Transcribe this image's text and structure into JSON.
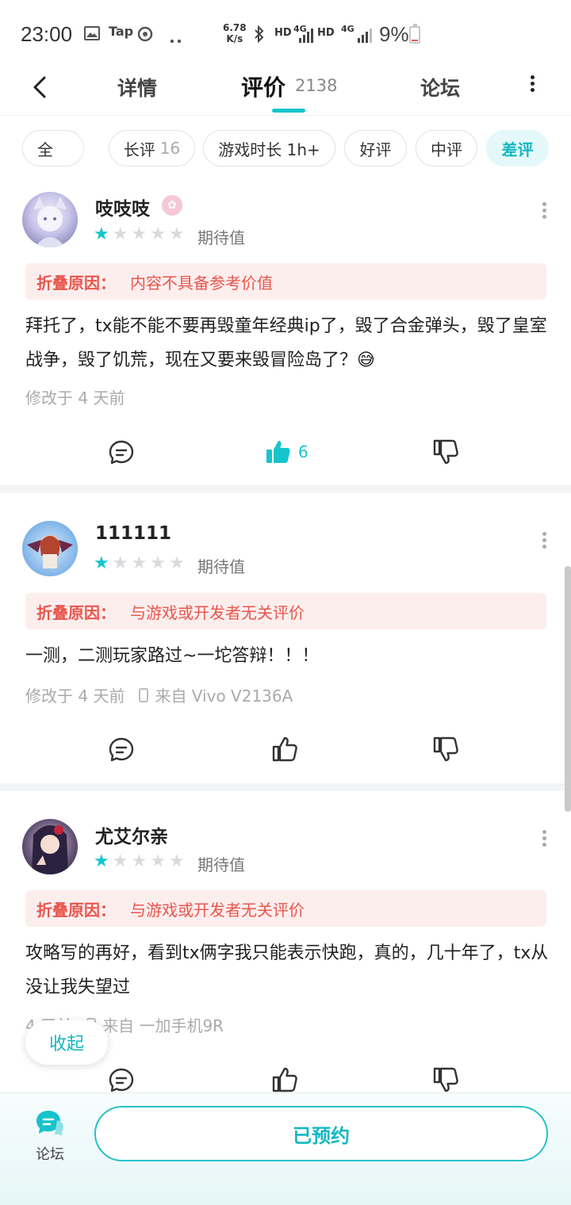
{
  "status_bar": {
    "time": "23:00",
    "icons": [
      "image-icon",
      "tap-icon",
      "refresh-icon",
      "more-dots-icon"
    ],
    "tap_label": "Tap",
    "net_speed_value": "6.78",
    "net_speed_unit": "K/s",
    "hd1": "HD",
    "net1": "4G",
    "hd2": "HD",
    "net2": "4G",
    "battery": "9%"
  },
  "nav": {
    "tabs": [
      {
        "label": "详情"
      },
      {
        "label": "评价",
        "count": "2138"
      },
      {
        "label": "论坛"
      }
    ],
    "active_tab": "评价",
    "accent_color": "#15c5ce"
  },
  "filters": [
    {
      "label": "全"
    },
    {
      "label": "长评",
      "count": "16"
    },
    {
      "label": "游戏时长 1h+"
    },
    {
      "label": "好评"
    },
    {
      "label": "中评"
    },
    {
      "label": "差评",
      "active": true
    }
  ],
  "reviews": [
    {
      "author": "吱吱吱",
      "rating": 1,
      "rating_label": "期待值",
      "fold_label": "折叠原因：",
      "fold_reason": "内容不具备参考价值",
      "text": "拜托了，tx能不能不要再毁童年经典ip了，毁了合金弹头，毁了皇室战争，毁了饥荒，现在又要来毁冒险岛了？😅",
      "meta_time": "修改于 4 天前",
      "likes": "6",
      "liked": true
    },
    {
      "author": "111111",
      "rating": 1,
      "rating_label": "期待值",
      "fold_label": "折叠原因：",
      "fold_reason": "与游戏或开发者无关评价",
      "text": "一测，二测玩家路过~一坨答辩！！！",
      "meta_time": "修改于 4 天前",
      "meta_device": "来自 Vivo V2136A",
      "liked": false
    },
    {
      "author": "尤艾尔亲",
      "rating": 1,
      "rating_label": "期待值",
      "fold_label": "折叠原因：",
      "fold_reason": "与游戏或开发者无关评价",
      "text": "攻略写的再好，看到tx俩字我只能表示快跑，真的，几十年了，tx从没让我失望过",
      "meta_time": "4 天前",
      "meta_device": "来自 一加手机9R",
      "liked": false
    }
  ],
  "collapse_label": "收起",
  "bottom": {
    "forum_label": "论坛",
    "reserve_label": "已预约"
  }
}
